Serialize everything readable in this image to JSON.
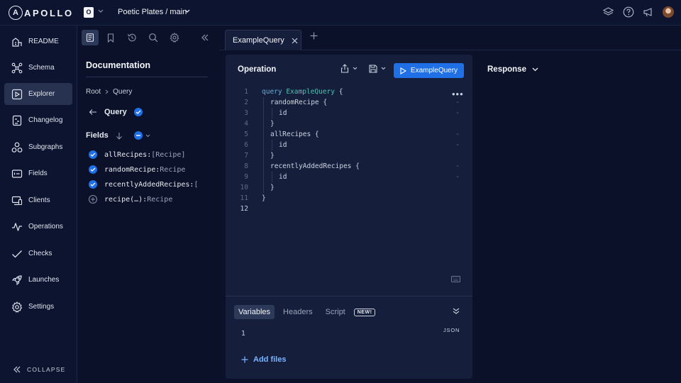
{
  "topbar": {
    "logo_text": "APOLLO",
    "logo_letter": "A",
    "org_initial": "O",
    "graph_title": "Poetic Plates / main"
  },
  "sidebar": {
    "items": [
      {
        "label": "README",
        "icon": "readme-icon",
        "active": false
      },
      {
        "label": "Schema",
        "icon": "schema-icon",
        "active": false
      },
      {
        "label": "Explorer",
        "icon": "explorer-icon",
        "active": true
      },
      {
        "label": "Changelog",
        "icon": "changelog-icon",
        "active": false
      },
      {
        "label": "Subgraphs",
        "icon": "subgraphs-icon",
        "active": false
      },
      {
        "label": "Fields",
        "icon": "fields-icon",
        "active": false
      },
      {
        "label": "Clients",
        "icon": "clients-icon",
        "active": false
      },
      {
        "label": "Operations",
        "icon": "operations-icon",
        "active": false
      },
      {
        "label": "Checks",
        "icon": "checks-icon",
        "active": false
      },
      {
        "label": "Launches",
        "icon": "launches-icon",
        "active": false
      },
      {
        "label": "Settings",
        "icon": "settings-icon",
        "active": false
      }
    ],
    "collapse_label": "COLLAPSE"
  },
  "docs": {
    "title": "Documentation",
    "breadcrumb": [
      "Root",
      "Query"
    ],
    "type_name": "Query",
    "fields_label": "Fields",
    "fields": [
      {
        "name": "allRecipes:",
        "type": "[Recipe]",
        "checked": true
      },
      {
        "name": "randomRecipe:",
        "type": "Recipe",
        "checked": true
      },
      {
        "name": "recentlyAddedRecipes:",
        "type": "[",
        "checked": true
      },
      {
        "name": "recipe(…):",
        "type": "Recipe",
        "checked": false
      }
    ]
  },
  "tabs": [
    {
      "label": "ExampleQuery"
    }
  ],
  "operation": {
    "title": "Operation",
    "run_label": "ExampleQuery",
    "lines": [
      {
        "n": "1",
        "indent": 0,
        "kw": "query",
        "name": "ExampleQuery",
        "rest": " {",
        "gutter": ""
      },
      {
        "n": "2",
        "indent": 1,
        "kw": "",
        "name": "",
        "rest": "randomRecipe {",
        "gutter": "-"
      },
      {
        "n": "3",
        "indent": 2,
        "kw": "",
        "name": "",
        "rest": "id",
        "gutter": "-"
      },
      {
        "n": "4",
        "indent": 1,
        "kw": "",
        "name": "",
        "rest": "}",
        "gutter": ""
      },
      {
        "n": "5",
        "indent": 1,
        "kw": "",
        "name": "",
        "rest": "allRecipes {",
        "gutter": "-"
      },
      {
        "n": "6",
        "indent": 2,
        "kw": "",
        "name": "",
        "rest": "id",
        "gutter": "-"
      },
      {
        "n": "7",
        "indent": 1,
        "kw": "",
        "name": "",
        "rest": "}",
        "gutter": ""
      },
      {
        "n": "8",
        "indent": 1,
        "kw": "",
        "name": "",
        "rest": "recentlyAddedRecipes {",
        "gutter": "-"
      },
      {
        "n": "9",
        "indent": 2,
        "kw": "",
        "name": "",
        "rest": "id",
        "gutter": "-"
      },
      {
        "n": "10",
        "indent": 1,
        "kw": "",
        "name": "",
        "rest": "}",
        "gutter": ""
      },
      {
        "n": "11",
        "indent": 0,
        "kw": "",
        "name": "",
        "rest": "}",
        "gutter": ""
      },
      {
        "n": "12",
        "indent": 0,
        "kw": "",
        "name": "",
        "rest": "",
        "gutter": ""
      }
    ],
    "current_line": "12"
  },
  "variables": {
    "tabs": [
      "Variables",
      "Headers",
      "Script"
    ],
    "new_badge": "NEW!",
    "json_label": "JSON",
    "line_number": "1",
    "add_files": "Add files"
  },
  "response": {
    "title": "Response"
  },
  "colors": {
    "accent": "#1f6fe6",
    "background": "#0b1129",
    "panel": "#151e3b"
  }
}
